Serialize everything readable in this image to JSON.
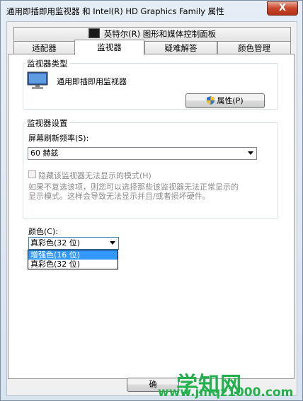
{
  "window": {
    "title": "通用即插即用监视器 和 Intel(R) HD Graphics Family 属性",
    "close_label": "X"
  },
  "tabs": {
    "top_row": [
      {
        "label": "英特尔(R) 图形和媒体控制面板",
        "icon": "intel-graphics-icon"
      }
    ],
    "bottom_row": [
      {
        "label": "适配器"
      },
      {
        "label": "监视器",
        "active": true
      },
      {
        "label": "疑难解答"
      },
      {
        "label": "颜色管理"
      }
    ]
  },
  "monitor_type": {
    "legend": "监视器类型",
    "icon": "monitor-icon",
    "name": "通用即插即用监视器",
    "properties_button": "属性(P)",
    "properties_icon": "uac-shield-icon"
  },
  "monitor_settings": {
    "legend": "监视器设置",
    "refresh_label": "屏幕刷新频率(S):",
    "refresh_value": "60 赫兹",
    "hide_modes_label": "隐藏该监视器无法显示的模式(H)",
    "hide_modes_checked": false,
    "description_line1": "如果不复选该项，则您可以选择那些该监视器无法正常显示的",
    "description_line2": "显示模式。这样会导致无法显示并且/或者损坏硬件。"
  },
  "colors": {
    "label": "颜色(C):",
    "selected": "真彩色(32 位)",
    "options": [
      "增强色(16 位)",
      "真彩色(32 位)"
    ],
    "highlighted_index": 0
  },
  "footer": {
    "ok_button_partial": "确"
  },
  "watermark": {
    "main": "学知网",
    "url": "www.jmqz1000.com"
  },
  "theme": {
    "selection": "#3399ff",
    "watermark_green": "#23b14d",
    "close_red": "#c7452a"
  }
}
